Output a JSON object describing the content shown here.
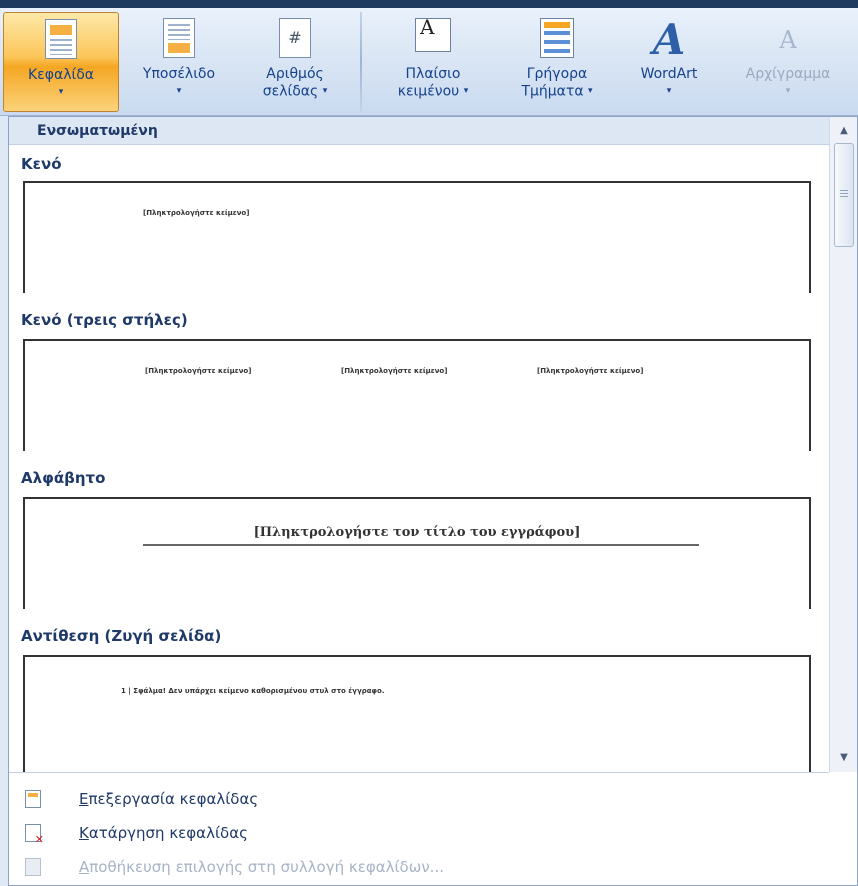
{
  "ribbon": {
    "header_button": {
      "label": "Κεφαλίδα"
    },
    "footer_button": {
      "label": "Υποσέλιδο"
    },
    "page_number_button": {
      "label_line1": "Αριθμός",
      "label_line2": "σελίδας"
    },
    "textbox_button": {
      "label_line1": "Πλαίσιο",
      "label_line2": "κειμένου"
    },
    "quickparts_button": {
      "label_line1": "Γρήγορα",
      "label_line2": "Τμήματα"
    },
    "wordart_button": {
      "label": "WordArt"
    },
    "dropcap_button": {
      "label": "Αρχίγραμμα"
    }
  },
  "gallery": {
    "category": "Ενσωματωμένη",
    "items": [
      {
        "title": "Κενό",
        "placeholders": [
          "[Πληκτρολογήστε κείμενο]"
        ]
      },
      {
        "title": "Κενό (τρεις στήλες)",
        "placeholders": [
          "[Πληκτρολογήστε κείμενο]",
          "[Πληκτρολογήστε κείμενο]",
          "[Πληκτρολογήστε κείμενο]"
        ]
      },
      {
        "title": "Αλφάβητο",
        "placeholders": [
          "[Πληκτρολογήστε τον τίτλο του εγγράφου]"
        ]
      },
      {
        "title": "Αντίθεση (Ζυγή σελίδα)",
        "placeholders": [
          "1 | Σφάλμα! Δεν υπάρχει κείμενο καθορισμένου στυλ στο έγγραφο."
        ]
      }
    ]
  },
  "menu": {
    "edit_header": "Επεξεργασία κεφαλίδας",
    "remove_header": "Κατάργηση κεφαλίδας",
    "save_selection": "Αποθήκευση επιλογής στη συλλογή κεφαλίδων..."
  },
  "icons": {
    "header": "header-doc-icon",
    "footer": "footer-doc-icon",
    "page_number": "page-number-icon",
    "textbox": "textbox-icon",
    "quickparts": "quickparts-icon",
    "wordart": "wordart-icon",
    "dropcap": "dropcap-icon",
    "caret": "▾",
    "hash": "#",
    "textbox_glyph": "A",
    "wordart_glyph": "A",
    "dropcap_glyph": "A",
    "scroll_up": "▲",
    "scroll_down": "▼"
  },
  "colors": {
    "accent_active": "#f5a623",
    "ribbon_text": "#15428b",
    "gallery_title": "#1f3a68",
    "disabled_text": "#a7b3c6"
  }
}
